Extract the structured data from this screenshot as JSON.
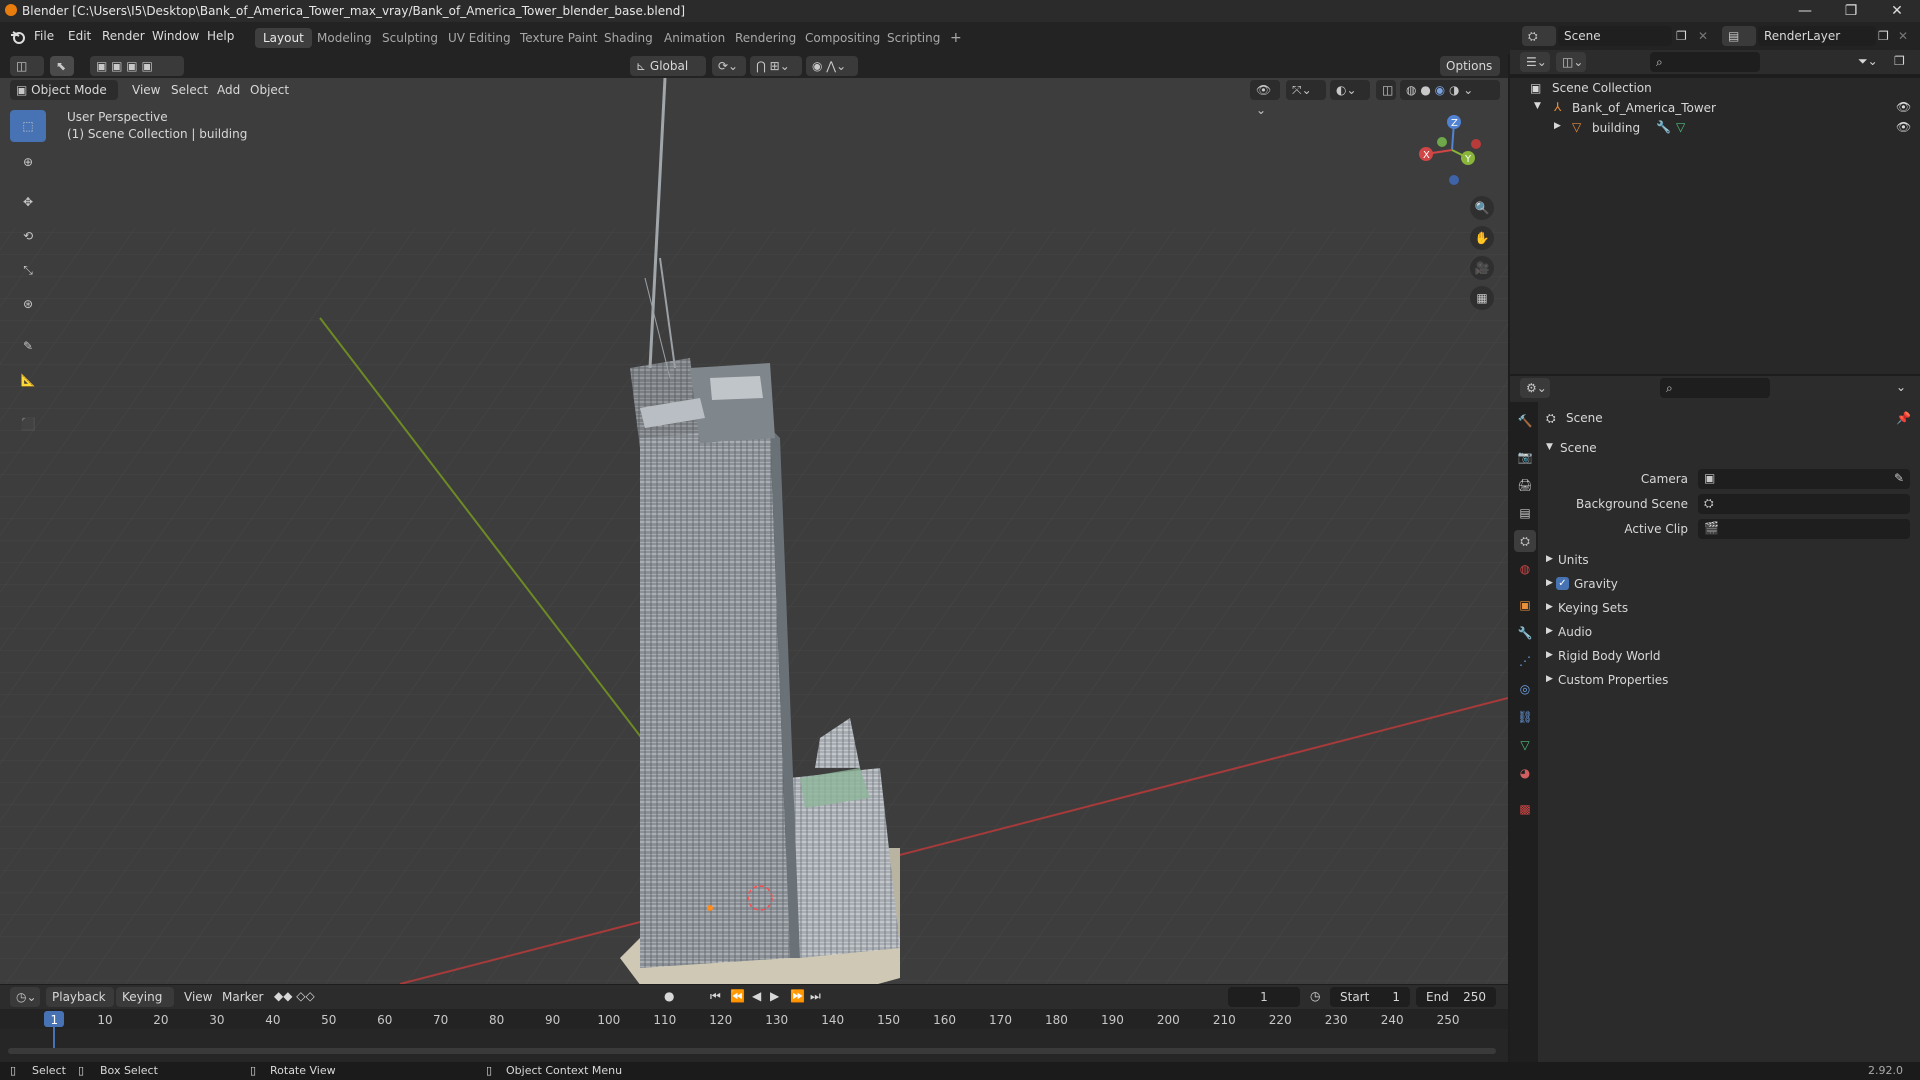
{
  "window": {
    "title": "Blender [C:\\Users\\I5\\Desktop\\Bank_of_America_Tower_max_vray/Bank_of_America_Tower_blender_base.blend]",
    "controls": [
      "—",
      "❐",
      "✕"
    ]
  },
  "menu": [
    "File",
    "Edit",
    "Render",
    "Window",
    "Help"
  ],
  "workspaces": {
    "tabs": [
      "Layout",
      "Modeling",
      "Sculpting",
      "UV Editing",
      "Texture Paint",
      "Shading",
      "Animation",
      "Rendering",
      "Compositing",
      "Scripting",
      "+"
    ],
    "active": "Layout"
  },
  "scene_selector": {
    "scene": "Scene",
    "render_layer": "RenderLayer"
  },
  "viewport_header": {
    "transform_orientation": "Global",
    "options": "Options",
    "mode": "Object Mode",
    "menus": [
      "View",
      "Select",
      "Add",
      "Object"
    ]
  },
  "viewport": {
    "overlay_line1": "User Perspective",
    "overlay_line2": "(1) Scene Collection | building",
    "gizmo": {
      "x": "X",
      "y": "Y",
      "z": "Z"
    }
  },
  "outliner": {
    "root": "Scene Collection",
    "items": [
      {
        "label": "Bank_of_America_Tower"
      },
      {
        "label": "building"
      }
    ]
  },
  "properties": {
    "header_title": "Scene",
    "panel_title": "Scene",
    "fields": [
      {
        "label": "Camera",
        "value": ""
      },
      {
        "label": "Background Scene",
        "value": ""
      },
      {
        "label": "Active Clip",
        "value": ""
      }
    ],
    "subpanels": [
      "Units",
      "Gravity",
      "Keying Sets",
      "Audio",
      "Rigid Body World",
      "Custom Properties"
    ],
    "gravity_checked": true
  },
  "timeline": {
    "menus": [
      "Playback",
      "Keying",
      "View",
      "Marker"
    ],
    "current_frame": "1",
    "start_label": "Start",
    "start": "1",
    "end_label": "End",
    "end": "250",
    "ticks": [
      "1",
      "10",
      "20",
      "30",
      "40",
      "50",
      "60",
      "70",
      "80",
      "90",
      "100",
      "110",
      "120",
      "130",
      "140",
      "150",
      "160",
      "170",
      "180",
      "190",
      "200",
      "210",
      "220",
      "230",
      "240",
      "250"
    ]
  },
  "statusbar": {
    "select": "Select",
    "box_select": "Box Select",
    "rotate_view": "Rotate View",
    "context_menu": "Object Context Menu",
    "version": "2.92.0"
  }
}
